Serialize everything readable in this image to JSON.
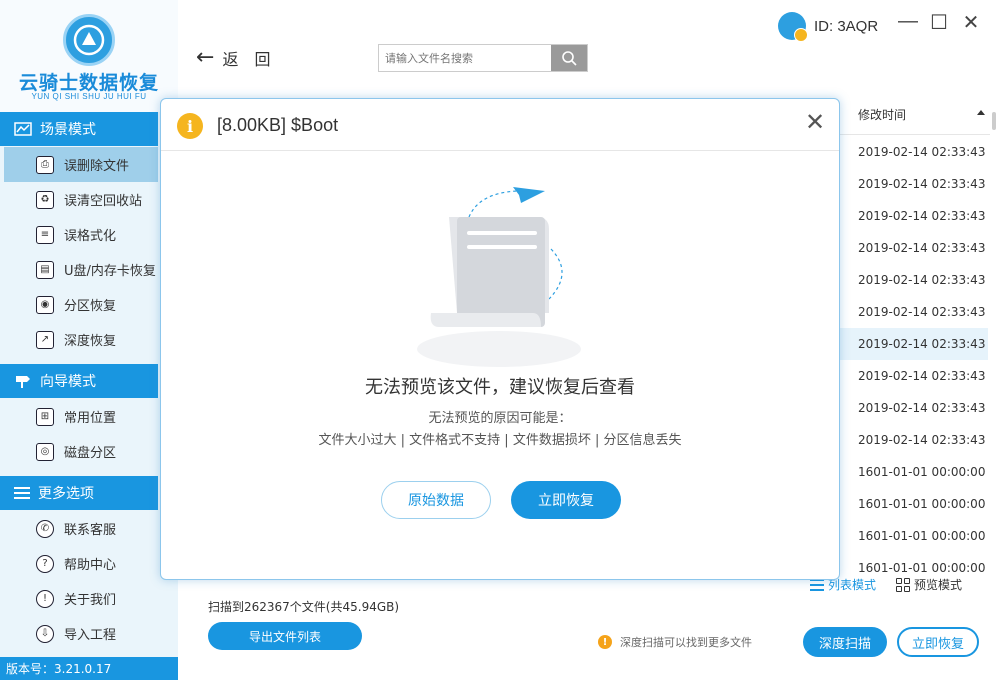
{
  "app": {
    "logo_title": "云骑士数据恢复",
    "logo_subtitle": "YUN QI SHI SHU JU HUI FU",
    "version": "版本号：3.21.0.17",
    "user_id": "ID: 3AQR",
    "accent_color": "#1996e0"
  },
  "sidebar": {
    "sections": [
      {
        "title": "场景模式",
        "icon": "scene-mode-icon"
      },
      {
        "title": "向导模式",
        "icon": "guide-mode-icon"
      },
      {
        "title": "更多选项",
        "icon": "more-options-icon"
      }
    ],
    "scene_items": [
      {
        "label": "误删除文件",
        "icon": "deleted-file-icon",
        "active": true
      },
      {
        "label": "误清空回收站",
        "icon": "recycle-bin-icon"
      },
      {
        "label": "误格式化",
        "icon": "format-icon"
      },
      {
        "label": "U盘/内存卡恢复",
        "icon": "usb-card-icon"
      },
      {
        "label": "分区恢复",
        "icon": "partition-icon"
      },
      {
        "label": "深度恢复",
        "icon": "deep-recovery-icon"
      }
    ],
    "guide_items": [
      {
        "label": "常用位置",
        "icon": "common-location-icon"
      },
      {
        "label": "磁盘分区",
        "icon": "disk-partition-icon"
      }
    ],
    "more_items": [
      {
        "label": "联系客服",
        "icon": "support-icon"
      },
      {
        "label": "帮助中心",
        "icon": "help-icon"
      },
      {
        "label": "关于我们",
        "icon": "about-icon"
      },
      {
        "label": "导入工程",
        "icon": "import-icon"
      }
    ]
  },
  "toolbar": {
    "back_label": "返　回",
    "search_placeholder": "请输入文件名搜索"
  },
  "table": {
    "column_modified": "修改时间",
    "rows": [
      "2019-02-14 02:33:43",
      "2019-02-14 02:33:43",
      "2019-02-14 02:33:43",
      "2019-02-14 02:33:43",
      "2019-02-14 02:33:43",
      "2019-02-14 02:33:43",
      "2019-02-14 02:33:43",
      "2019-02-14 02:33:43",
      "2019-02-14 02:33:43",
      "2019-02-14 02:33:43",
      "1601-01-01 00:00:00",
      "1601-01-01 00:00:00",
      "1601-01-01 00:00:00",
      "1601-01-01 00:00:00"
    ],
    "selected_row_index": 6
  },
  "view_modes": {
    "list": "列表模式",
    "preview": "预览模式"
  },
  "footer": {
    "scan_info": "扫描到262367个文件(共45.94GB)",
    "export_label": "导出文件列表",
    "hint": "深度扫描可以找到更多文件",
    "deep_scan_label": "深度扫描",
    "recover_label": "立即恢复"
  },
  "modal": {
    "title": "[8.00KB] $Boot",
    "main_message": "无法预览该文件，建议恢复后查看",
    "sub_message": "无法预览的原因可能是：",
    "reasons": "文件大小过大 | 文件格式不支持 | 文件数据损坏 | 分区信息丢失",
    "raw_button": "原始数据",
    "recover_button": "立即恢复"
  }
}
